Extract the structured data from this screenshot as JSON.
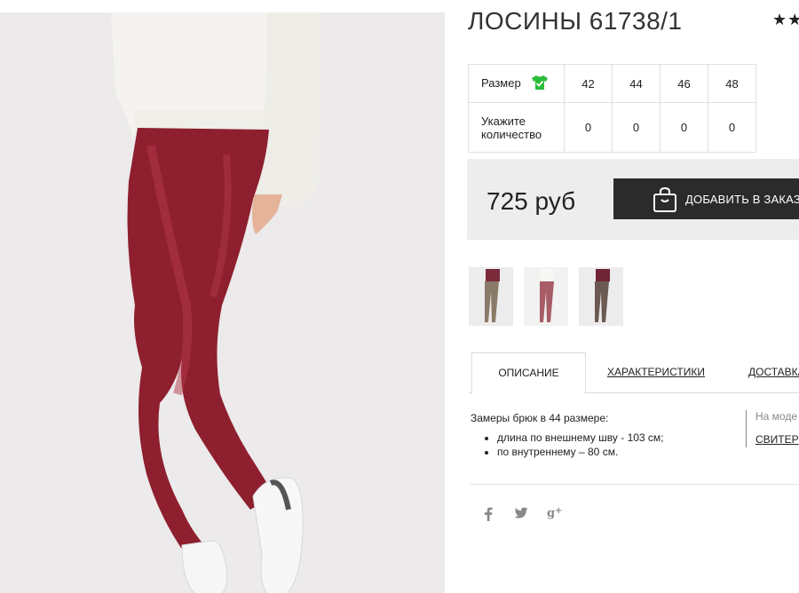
{
  "product": {
    "title": "ЛОСИНЫ 61738/1",
    "rating_stars": "★★"
  },
  "sizes_table": {
    "size_label": "Размер",
    "size_icon": "tshirt-check-icon",
    "sizes": [
      "42",
      "44",
      "46",
      "48"
    ],
    "qty_label": "Укажите количество",
    "quantities": [
      "0",
      "0",
      "0",
      "0"
    ]
  },
  "order": {
    "price": "725 руб",
    "button_label": "ДОБАВИТЬ В ЗАКАЗ",
    "button_icon": "shopping-bag-icon"
  },
  "thumbnails": [
    {
      "name": "thumb-1",
      "color": "#8a7a68"
    },
    {
      "name": "thumb-2",
      "color": "#a85c66"
    },
    {
      "name": "thumb-3",
      "color": "#6b5a52"
    }
  ],
  "tabs": [
    {
      "label": "ОПИСАНИЕ",
      "active": true
    },
    {
      "label": "ХАРАКТЕРИСТИКИ",
      "active": false
    },
    {
      "label": "ДОСТАВКА",
      "active": false
    }
  ],
  "description": {
    "intro": "Замеры брюк в 44 размере:",
    "items": [
      "длина по внешнему шву - 103 см;",
      "по внутреннему – 80 см."
    ]
  },
  "model_info": {
    "label": "На моде",
    "link": "СВИТЕР"
  },
  "social": [
    "facebook-icon",
    "twitter-icon",
    "google-plus-icon"
  ],
  "colors": {
    "accent_green": "#2dbb3a",
    "button_dark": "#2b2b2b",
    "leggings": "#8e1f2e"
  }
}
